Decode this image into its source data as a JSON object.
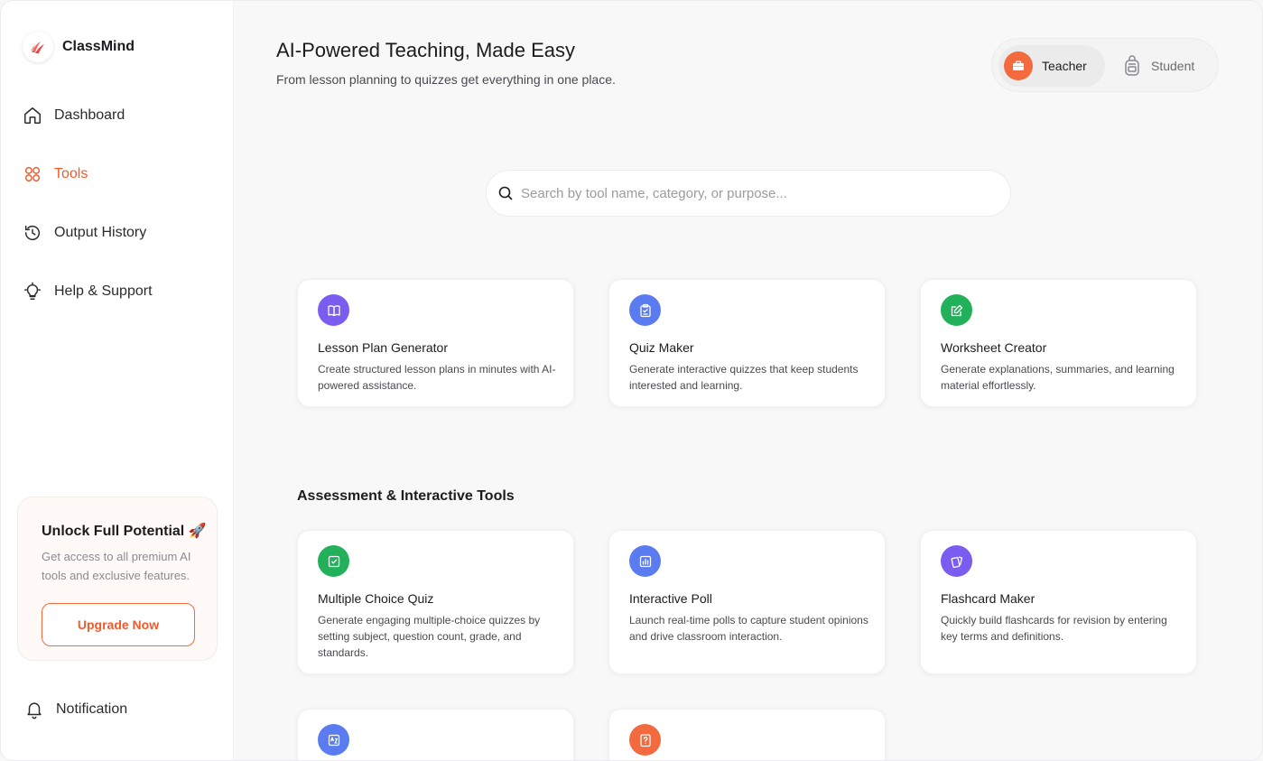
{
  "brand": {
    "name": "ClassMind"
  },
  "nav": [
    {
      "label": "Dashboard",
      "icon": "home-icon",
      "active": false
    },
    {
      "label": "Tools",
      "icon": "tools-icon",
      "active": true
    },
    {
      "label": "Output History",
      "icon": "history-icon",
      "active": false
    },
    {
      "label": "Help & Support",
      "icon": "lightbulb-icon",
      "active": false
    }
  ],
  "promo": {
    "title": "Unlock Full Potential 🚀",
    "description": "Get access to all premium AI tools and exclusive features.",
    "button": "Upgrade Now"
  },
  "notification": {
    "label": "Notification"
  },
  "header": {
    "title": "AI-Powered Teaching, Made Easy",
    "subtitle": "From lesson planning to quizzes get everything in one place."
  },
  "roles": {
    "teacher": "Teacher",
    "student": "Student",
    "selected": "Teacher"
  },
  "search": {
    "placeholder": "Search by tool name, category, or purpose...",
    "value": ""
  },
  "section": {
    "title": "Assessment & Interactive Tools"
  },
  "cards": [
    {
      "title": "Lesson Plan Generator",
      "desc": "Create structured lesson plans in minutes with AI-powered assistance.",
      "icon": "book-icon",
      "color": "#7b5cf0"
    },
    {
      "title": "Quiz Maker",
      "desc": "Generate interactive quizzes that keep students interested and learning.",
      "icon": "clipboard-icon",
      "color": "#5b7cf0"
    },
    {
      "title": "Worksheet Creator",
      "desc": "Generate explanations, summaries, and learning material effortlessly.",
      "icon": "edit-icon",
      "color": "#22b15a"
    },
    {
      "title": "Multiple Choice Quiz",
      "desc": "Generate engaging multiple-choice quizzes by setting subject, question count, grade, and standards.",
      "icon": "checkbox-icon",
      "color": "#22b15a"
    },
    {
      "title": "Interactive Poll",
      "desc": "Launch real-time polls to capture student opinions and drive classroom interaction.",
      "icon": "poll-icon",
      "color": "#5b7cf0"
    },
    {
      "title": "Flashcard Maker",
      "desc": "Quickly build flashcards for revision by entering key terms and definitions.",
      "icon": "flashcard-icon",
      "color": "#7b5cf0"
    },
    {
      "title": "",
      "desc": "",
      "icon": "dictionary-icon",
      "color": "#5b7cf0"
    },
    {
      "title": "",
      "desc": "",
      "icon": "question-icon",
      "color": "#f26a3d"
    }
  ]
}
